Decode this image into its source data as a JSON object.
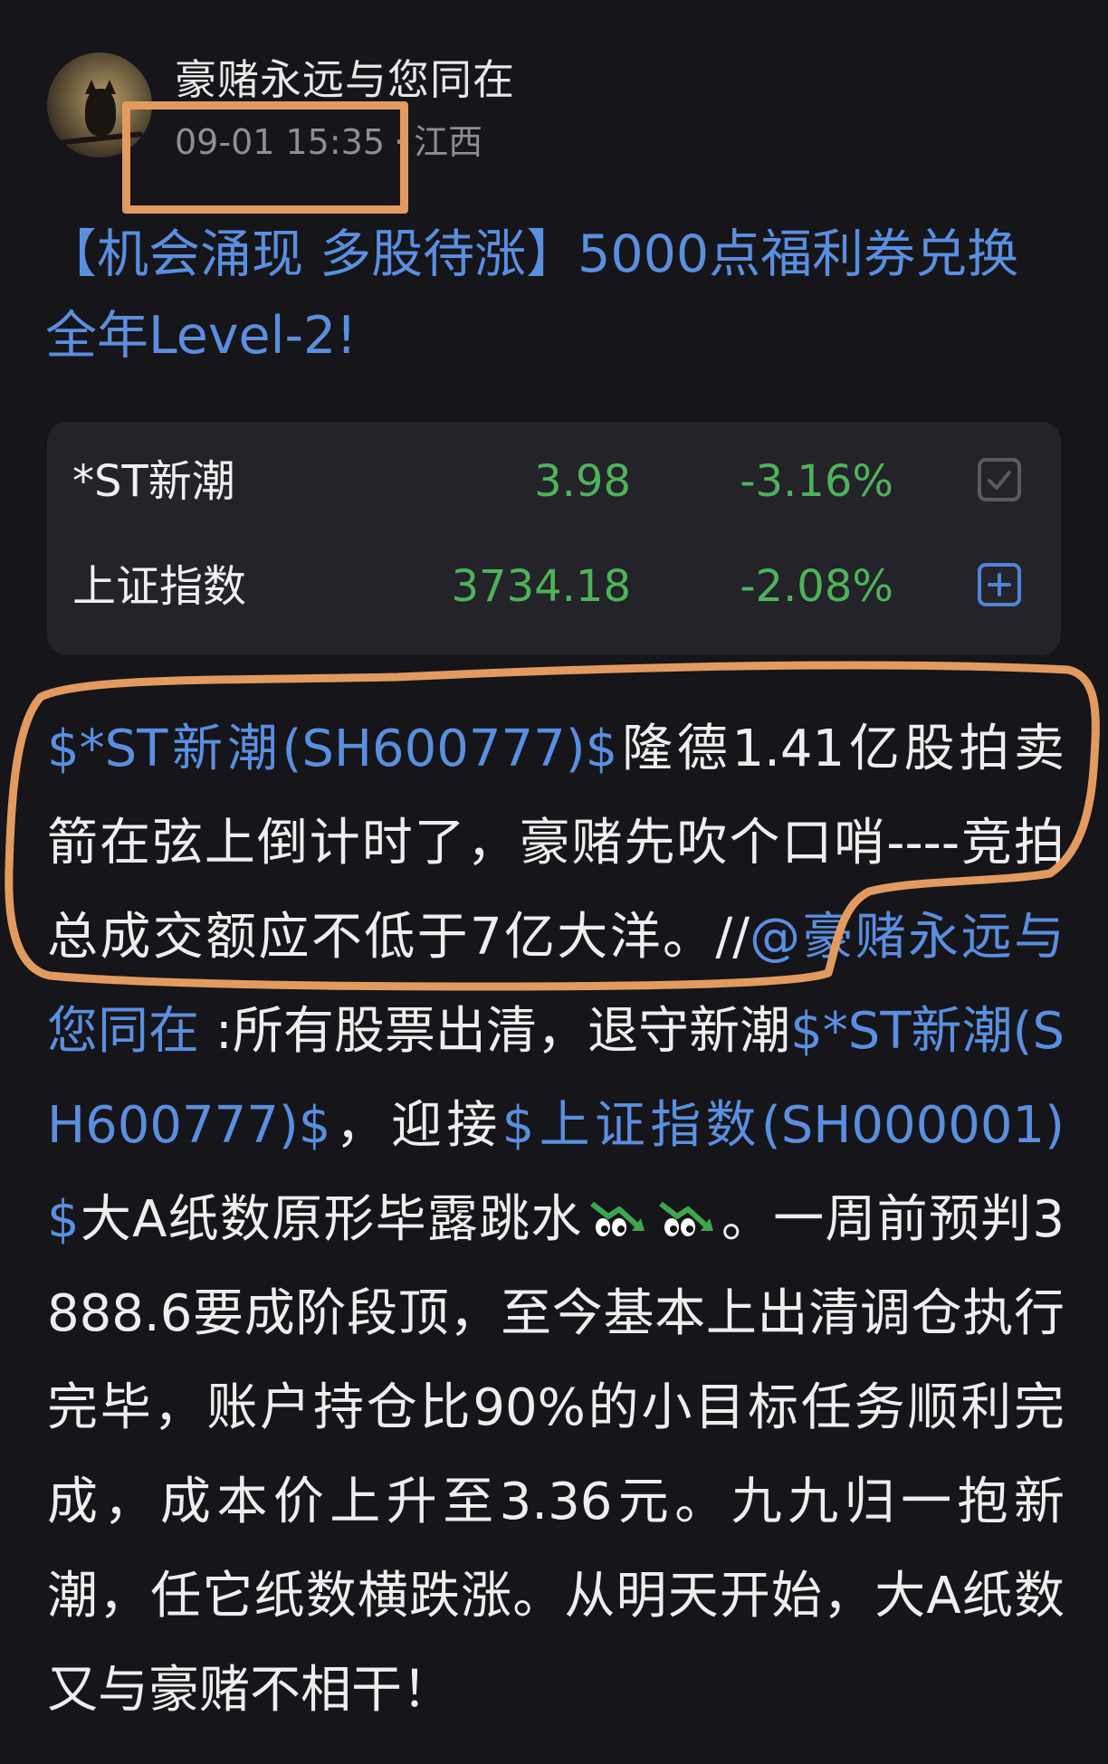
{
  "header": {
    "username": "豪赌永远与您同在",
    "timestamp": "09-01 15:35",
    "separator": "·",
    "location": "江西"
  },
  "post": {
    "title": "【机会涌现 多股待涨】5000点福利券兑换全年Level-2!",
    "body": {
      "link1": "$*ST新潮(SH600777)$",
      "text1": "隆德1.41亿股拍卖箭在弦上倒计时了，豪赌先吹个口哨----竞拍总成交额应不低于7亿大洋。//",
      "mention": "@豪赌永远与您同在",
      "text2": " :所有股票出清，退守新潮",
      "link2": "$*ST新潮(SH600777)$",
      "text3": "，迎接",
      "link3": "$上证指数(SH000001)$",
      "text4": "大A纸数原形毕露跳水",
      "text5": "。一周前预判3888.6要成阶段顶，至今基本上出清调仓执行完毕，账户持仓比90%的小目标任务顺利完成，成本价上升至3.36元。九九归一抱新潮，任它纸数横跌涨。从明天开始，大A纸数又与豪赌不相干！"
    }
  },
  "stocks": [
    {
      "name": "*ST新潮",
      "price": "3.98",
      "change": "-3.16%",
      "action_icon": "check-square-icon"
    },
    {
      "name": "上证指数",
      "price": "3734.18",
      "change": "-2.08%",
      "action_icon": "plus-square-icon"
    }
  ],
  "colors": {
    "background": "#15151a",
    "card": "#232329",
    "link": "#5a8fe0",
    "down_green": "#4eb35a",
    "annotation_orange": "#e39a5f"
  }
}
